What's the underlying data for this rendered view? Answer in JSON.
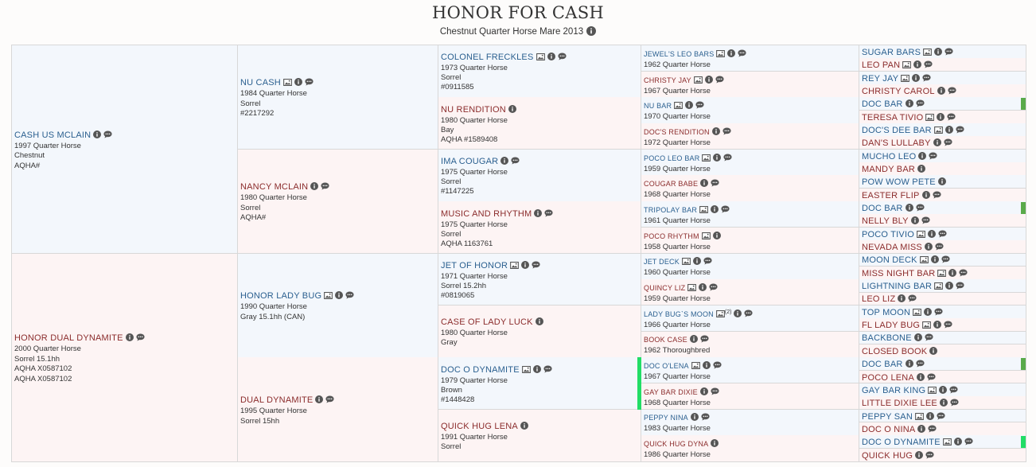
{
  "header": {
    "title": "HONOR FOR CASH",
    "subtitle": "Chestnut Quarter Horse Mare 2013"
  },
  "colors": {
    "sire_bg": "#f3f7fc",
    "dam_bg": "#fdf4f4",
    "sire_text": "#2a5f8f",
    "dam_text": "#8b2c2c",
    "marker_green": "#5aaa4a",
    "marker_bright_green": "#22dd66"
  },
  "pedigree": {
    "gen1": [
      {
        "name": "CASH US MCLAIN",
        "sex": "sire",
        "icons": [
          "info-icon",
          "comment-icon"
        ],
        "lines": [
          "1997 Quarter Horse",
          "Chestnut",
          "AQHA#"
        ]
      },
      {
        "name": "HONOR DUAL DYNAMITE",
        "sex": "dam",
        "icons": [
          "info-icon",
          "comment-icon"
        ],
        "lines": [
          "2000 Quarter Horse",
          "Sorrel 15.1hh",
          "AQHA X0587102",
          "AQHA X0587102"
        ]
      }
    ],
    "gen2": [
      {
        "name": "NU CASH",
        "sex": "sire",
        "icons": [
          "photo-icon",
          "info-icon",
          "comment-icon"
        ],
        "lines": [
          "1984 Quarter Horse",
          "Sorrel",
          "#2217292"
        ]
      },
      {
        "name": "NANCY MCLAIN",
        "sex": "dam",
        "icons": [
          "info-icon",
          "comment-icon"
        ],
        "lines": [
          "1980 Quarter Horse",
          "Sorrel",
          "AQHA#"
        ]
      },
      {
        "name": "HONOR LADY BUG",
        "sex": "sire",
        "icons": [
          "photo-icon",
          "info-icon",
          "comment-icon"
        ],
        "lines": [
          "1990 Quarter Horse",
          "Gray 15.1hh (CAN)"
        ]
      },
      {
        "name": "DUAL DYNAMITE",
        "sex": "dam",
        "icons": [
          "info-icon",
          "comment-icon"
        ],
        "lines": [
          "1995 Quarter Horse",
          "Sorrel 15hh"
        ]
      }
    ],
    "gen3": [
      {
        "name": "COLONEL FRECKLES",
        "sex": "sire",
        "icons": [
          "photo-icon",
          "info-icon",
          "comment-icon"
        ],
        "lines": [
          "1973 Quarter Horse",
          "Sorrel",
          "#0911585"
        ]
      },
      {
        "name": "NU RENDITION",
        "sex": "dam",
        "icons": [
          "info-icon"
        ],
        "lines": [
          "1980 Quarter Horse",
          "Bay",
          "AQHA #1589408"
        ]
      },
      {
        "name": "IMA COUGAR",
        "sex": "sire",
        "icons": [
          "info-icon",
          "comment-icon"
        ],
        "lines": [
          "1975 Quarter Horse",
          "Sorrel",
          "#1147225"
        ]
      },
      {
        "name": "MUSIC AND RHYTHM",
        "sex": "dam",
        "icons": [
          "info-icon",
          "comment-icon"
        ],
        "lines": [
          "1975 Quarter Horse",
          "Sorrel",
          "AQHA 1163761"
        ]
      },
      {
        "name": "JET OF HONOR",
        "sex": "sire",
        "icons": [
          "photo-icon",
          "info-icon",
          "comment-icon"
        ],
        "lines": [
          "1971 Quarter Horse",
          "Sorrel 15.2hh",
          "#0819065"
        ]
      },
      {
        "name": "CASE OF LADY LUCK",
        "sex": "dam",
        "icons": [
          "info-icon"
        ],
        "lines": [
          "1980 Quarter Horse",
          "Gray"
        ]
      },
      {
        "name": "DOC O DYNAMITE",
        "sex": "sire",
        "icons": [
          "photo-icon",
          "info-icon",
          "comment-icon"
        ],
        "lines": [
          "1979 Quarter Horse",
          "Brown",
          "#1448428"
        ]
      },
      {
        "name": "QUICK HUG LENA",
        "sex": "dam",
        "icons": [
          "info-icon"
        ],
        "lines": [
          "1991 Quarter Horse",
          "Sorrel"
        ]
      }
    ],
    "gen4": [
      {
        "name": "JEWEL'S LEO BARS",
        "sex": "sire",
        "icons": [
          "photo-icon",
          "info-icon",
          "comment-icon"
        ],
        "lines": [
          "1962 Quarter Horse"
        ]
      },
      {
        "name": "CHRISTY JAY",
        "sex": "dam",
        "icons": [
          "photo-icon",
          "info-icon",
          "comment-icon"
        ],
        "lines": [
          "1967 Quarter Horse"
        ]
      },
      {
        "name": "NU BAR",
        "sex": "sire",
        "icons": [
          "photo-icon",
          "info-icon",
          "comment-icon"
        ],
        "lines": [
          "1970 Quarter Horse"
        ]
      },
      {
        "name": "DOC'S RENDITION",
        "sex": "dam",
        "icons": [
          "info-icon",
          "comment-icon"
        ],
        "lines": [
          "1972 Quarter Horse"
        ]
      },
      {
        "name": "POCO LEO BAR",
        "sex": "sire",
        "icons": [
          "photo-icon",
          "info-icon",
          "comment-icon"
        ],
        "lines": [
          "1959 Quarter Horse"
        ]
      },
      {
        "name": "COUGAR BABE",
        "sex": "dam",
        "icons": [
          "info-icon",
          "comment-icon"
        ],
        "lines": [
          "1968 Quarter Horse"
        ]
      },
      {
        "name": "TRIPOLAY BAR",
        "sex": "sire",
        "icons": [
          "photo-icon",
          "info-icon",
          "comment-icon"
        ],
        "lines": [
          "1961 Quarter Horse"
        ]
      },
      {
        "name": "POCO RHYTHM",
        "sex": "dam",
        "icons": [
          "photo-icon",
          "info-icon"
        ],
        "lines": [
          "1958 Quarter Horse"
        ]
      },
      {
        "name": "JET DECK",
        "sex": "sire",
        "icons": [
          "photo-icon",
          "info-icon",
          "comment-icon"
        ],
        "lines": [
          "1960 Quarter Horse"
        ]
      },
      {
        "name": "QUINCY LIZ",
        "sex": "dam",
        "icons": [
          "photo-icon",
          "info-icon",
          "comment-icon"
        ],
        "lines": [
          "1959 Quarter Horse"
        ]
      },
      {
        "name": "LADY BUG`S MOON",
        "sex": "sire",
        "icons": [
          "photo-icon",
          "info-icon",
          "comment-icon"
        ],
        "photo_count": "(2)",
        "lines": [
          "1966 Quarter Horse"
        ]
      },
      {
        "name": "BOOK CASE",
        "sex": "dam",
        "icons": [
          "info-icon",
          "comment-icon"
        ],
        "lines": [
          "1962 Thoroughbred"
        ]
      },
      {
        "name": "DOC O'LENA",
        "sex": "sire",
        "icons": [
          "photo-icon",
          "info-icon",
          "comment-icon"
        ],
        "lines": [
          "1967 Quarter Horse"
        ]
      },
      {
        "name": "GAY BAR DIXIE",
        "sex": "dam",
        "icons": [
          "info-icon",
          "comment-icon"
        ],
        "lines": [
          "1968 Quarter Horse"
        ]
      },
      {
        "name": "PEPPY NINA",
        "sex": "sire",
        "icons": [
          "info-icon",
          "comment-icon"
        ],
        "lines": [
          "1983 Quarter Horse"
        ]
      },
      {
        "name": "QUICK HUG DYNA",
        "sex": "dam",
        "icons": [
          "info-icon"
        ],
        "lines": [
          "1986 Quarter Horse"
        ]
      }
    ],
    "gen5": [
      {
        "name": "SUGAR BARS",
        "sex": "sire",
        "icons": [
          "photo-icon",
          "info-icon",
          "comment-icon"
        ]
      },
      {
        "name": "LEO PAN",
        "sex": "dam",
        "icons": [
          "photo-icon",
          "info-icon",
          "comment-icon"
        ]
      },
      {
        "name": "REY JAY",
        "sex": "sire",
        "icons": [
          "photo-icon",
          "info-icon",
          "comment-icon"
        ]
      },
      {
        "name": "CHRISTY CAROL",
        "sex": "dam",
        "icons": [
          "info-icon",
          "comment-icon"
        ]
      },
      {
        "name": "DOC BAR",
        "sex": "sire",
        "icons": [
          "info-icon",
          "comment-icon"
        ],
        "marker": true
      },
      {
        "name": "TERESA TIVIO",
        "sex": "dam",
        "icons": [
          "photo-icon",
          "info-icon",
          "comment-icon"
        ]
      },
      {
        "name": "DOC'S DEE BAR",
        "sex": "sire",
        "icons": [
          "photo-icon",
          "info-icon",
          "comment-icon"
        ]
      },
      {
        "name": "DAN'S LULLABY",
        "sex": "dam",
        "icons": [
          "info-icon",
          "comment-icon"
        ]
      },
      {
        "name": "MUCHO LEO",
        "sex": "sire",
        "icons": [
          "info-icon",
          "comment-icon"
        ]
      },
      {
        "name": "MANDY BAR",
        "sex": "dam",
        "icons": [
          "info-icon"
        ]
      },
      {
        "name": "POW WOW PETE",
        "sex": "sire",
        "icons": [
          "info-icon"
        ]
      },
      {
        "name": "EASTER FLIP",
        "sex": "dam",
        "icons": [
          "info-icon",
          "comment-icon"
        ]
      },
      {
        "name": "DOC BAR",
        "sex": "sire",
        "icons": [
          "info-icon",
          "comment-icon"
        ],
        "marker": true
      },
      {
        "name": "NELLY BLY",
        "sex": "dam",
        "icons": [
          "info-icon",
          "comment-icon"
        ]
      },
      {
        "name": "POCO TIVIO",
        "sex": "sire",
        "icons": [
          "photo-icon",
          "info-icon",
          "comment-icon"
        ]
      },
      {
        "name": "NEVADA MISS",
        "sex": "dam",
        "icons": [
          "info-icon",
          "comment-icon"
        ]
      },
      {
        "name": "MOON DECK",
        "sex": "sire",
        "icons": [
          "photo-icon",
          "info-icon",
          "comment-icon"
        ]
      },
      {
        "name": "MISS NIGHT BAR",
        "sex": "dam",
        "icons": [
          "photo-icon",
          "info-icon",
          "comment-icon"
        ]
      },
      {
        "name": "LIGHTNING BAR",
        "sex": "sire",
        "icons": [
          "photo-icon",
          "info-icon",
          "comment-icon"
        ]
      },
      {
        "name": "LEO LIZ",
        "sex": "dam",
        "icons": [
          "info-icon",
          "comment-icon"
        ]
      },
      {
        "name": "TOP MOON",
        "sex": "sire",
        "icons": [
          "photo-icon",
          "info-icon",
          "comment-icon"
        ]
      },
      {
        "name": "FL LADY BUG",
        "sex": "dam",
        "icons": [
          "photo-icon",
          "info-icon",
          "comment-icon"
        ]
      },
      {
        "name": "BACKBONE",
        "sex": "sire",
        "icons": [
          "info-icon",
          "comment-icon"
        ]
      },
      {
        "name": "CLOSED BOOK",
        "sex": "dam",
        "icons": [
          "info-icon"
        ]
      },
      {
        "name": "DOC BAR",
        "sex": "sire",
        "icons": [
          "info-icon",
          "comment-icon"
        ],
        "marker": true
      },
      {
        "name": "POCO LENA",
        "sex": "dam",
        "icons": [
          "info-icon",
          "comment-icon"
        ]
      },
      {
        "name": "GAY BAR KING",
        "sex": "sire",
        "icons": [
          "photo-icon",
          "info-icon",
          "comment-icon"
        ]
      },
      {
        "name": "LITTLE DIXIE LEE",
        "sex": "dam",
        "icons": [
          "info-icon",
          "comment-icon"
        ]
      },
      {
        "name": "PEPPY SAN",
        "sex": "sire",
        "icons": [
          "photo-icon",
          "info-icon",
          "comment-icon"
        ]
      },
      {
        "name": "DOC O NINA",
        "sex": "dam",
        "icons": [
          "info-icon",
          "comment-icon"
        ]
      },
      {
        "name": "DOC O DYNAMITE",
        "sex": "sire",
        "icons": [
          "photo-icon",
          "info-icon",
          "comment-icon"
        ],
        "marker": "bright"
      },
      {
        "name": "QUICK HUG",
        "sex": "dam",
        "icons": [
          "info-icon",
          "comment-icon"
        ]
      }
    ]
  }
}
